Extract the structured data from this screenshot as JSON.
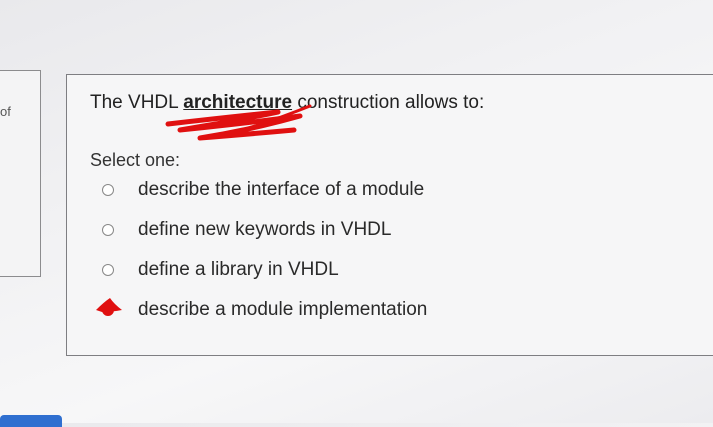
{
  "sidebar": {
    "fragment_text": "of"
  },
  "question": {
    "prefix": "The VHDL ",
    "keyword": "architecture",
    "suffix": " construction allows to:"
  },
  "select_label": "Select one:",
  "options": [
    {
      "label": "describe the interface of a module",
      "selected": false
    },
    {
      "label": "define new keywords in VHDL",
      "selected": false
    },
    {
      "label": "define a library in VHDL",
      "selected": false
    },
    {
      "label": "describe a module implementation",
      "selected": true
    }
  ],
  "colors": {
    "annotation": "#e01010",
    "button": "#2f6fd0"
  }
}
